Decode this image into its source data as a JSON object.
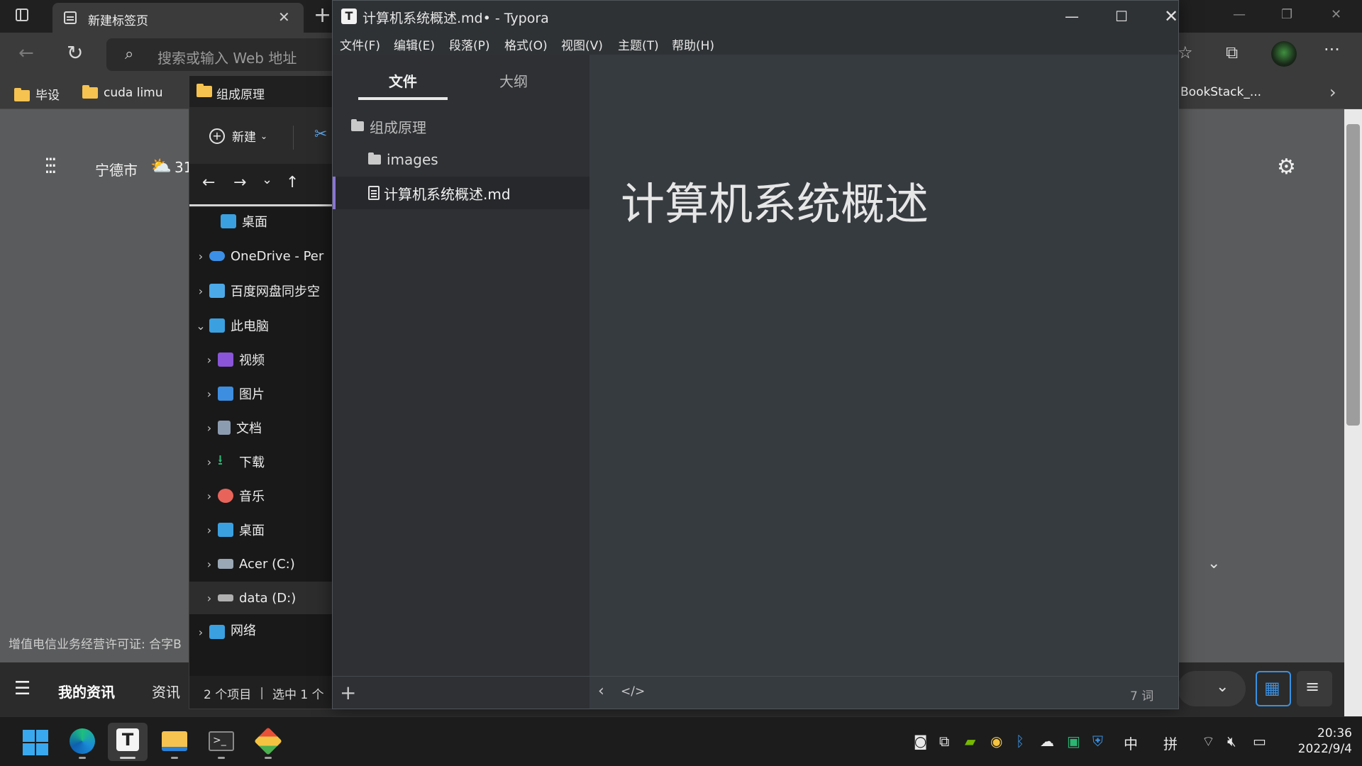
{
  "edge": {
    "tab_title": "新建标签页",
    "tab_close": "✕",
    "new_tab": "+",
    "address_placeholder": "搜索或输入 Web 地址",
    "bookmarks": [
      "毕设",
      "cuda limu"
    ],
    "bookmark_right": "BookStack_...",
    "location": "宁德市",
    "temp": "31",
    "license_text": "增值电信业务经营许可证: 合字B",
    "feed_tabs": [
      "我的资讯",
      "资讯"
    ],
    "window_buttons": [
      "—",
      "❐",
      "✕"
    ]
  },
  "explorer": {
    "title": "组成原理",
    "new_label": "新建",
    "tree": [
      {
        "label": "桌面",
        "expander": "",
        "indent": 1,
        "color": "#3aa0e0"
      },
      {
        "label": "OneDrive - Per",
        "expander": "›",
        "indent": 0,
        "color": "#3c8fe6"
      },
      {
        "label": "百度网盘同步空",
        "expander": "›",
        "indent": 0,
        "color": "#4ba9e8"
      },
      {
        "label": "此电脑",
        "expander": "⌄",
        "indent": 0,
        "color": "#3aa0e0"
      },
      {
        "label": "视频",
        "expander": "›",
        "indent": 1,
        "color": "#8a55d8"
      },
      {
        "label": "图片",
        "expander": "›",
        "indent": 1,
        "color": "#3d8ee0"
      },
      {
        "label": "文档",
        "expander": "›",
        "indent": 1,
        "color": "#8c9cb0"
      },
      {
        "label": "下载",
        "expander": "›",
        "indent": 1,
        "color": "#2bb673"
      },
      {
        "label": "音乐",
        "expander": "›",
        "indent": 1,
        "color": "#e8645a"
      },
      {
        "label": "桌面",
        "expander": "›",
        "indent": 1,
        "color": "#3aa0e0"
      },
      {
        "label": "Acer (C:)",
        "expander": "›",
        "indent": 1,
        "color": "#9aa7b5"
      },
      {
        "label": "data (D:)",
        "expander": "›",
        "indent": 1,
        "color": "#b0b0b0"
      },
      {
        "label": "网络",
        "expander": "›",
        "indent": 0,
        "color": "#3aa0e0"
      }
    ],
    "status_items": "2 个项目",
    "status_selected": "选中 1 个"
  },
  "typora": {
    "window_title": "计算机系统概述.md• - Typora",
    "menu": [
      "文件(F)",
      "编辑(E)",
      "段落(P)",
      "格式(O)",
      "视图(V)",
      "主题(T)",
      "帮助(H)"
    ],
    "sidebar_tabs": {
      "files": "文件",
      "outline": "大纲"
    },
    "tree": {
      "root": "组成原理",
      "folder": "images",
      "file": "计算机系统概述.md"
    },
    "heading": "计算机系统概述",
    "word_count": "7 词",
    "add_button": "+"
  },
  "taskbar": {
    "tray_ime_1": "中",
    "tray_ime_2": "拼",
    "time": "20:36",
    "date": "2022/9/4"
  }
}
